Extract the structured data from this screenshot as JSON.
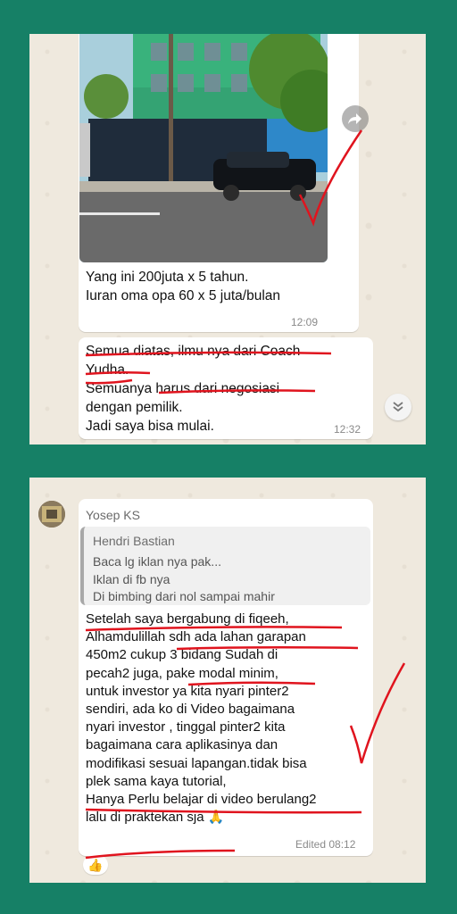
{
  "top_panel": {
    "message1": {
      "text": "Yang ini 200juta x 5 tahun.\nIuran oma opa 60 x 5 juta/bulan",
      "time": "12:09",
      "forward_icon": "forward-icon"
    },
    "message2": {
      "text": "Semua diatas, ilmu nya dari Coach\nYudha.\nSemuanya harus dari negosiasi\ndengan pemilik.\nJadi saya bisa mulai.",
      "time": "12:32"
    },
    "scroll_icon": "double-chevron-down-icon"
  },
  "bottom_panel": {
    "sender": "Yosep KS",
    "quote": {
      "author": "Hendri Bastian",
      "text": "Baca lg iklan nya pak...\nIklan di fb nya\nDi bimbing dari nol sampai mahir"
    },
    "message": {
      "text": "Setelah saya bergabung di fiqeeh,\nAlhamdulillah sdh ada lahan garapan\n450m2 cukup 3 bidang Sudah di\npecah2 juga, pake modal minim,\nuntuk investor ya kita nyari pinter2\nsendiri, ada ko di Video bagaimana\nnyari investor , tinggal pinter2 kita\nbagaimana cara aplikasinya dan\nmodifikasi sesuai lapangan.tidak bisa\nplek sama kaya tutorial,\nHanya Perlu belajar di video berulang2\nlalu di praktekan sja 🙏",
      "time": "Edited 08:12"
    },
    "reaction": "👍"
  },
  "colors": {
    "background": "#168066",
    "panel": "#efe9de",
    "annotation": "#e0141e"
  }
}
